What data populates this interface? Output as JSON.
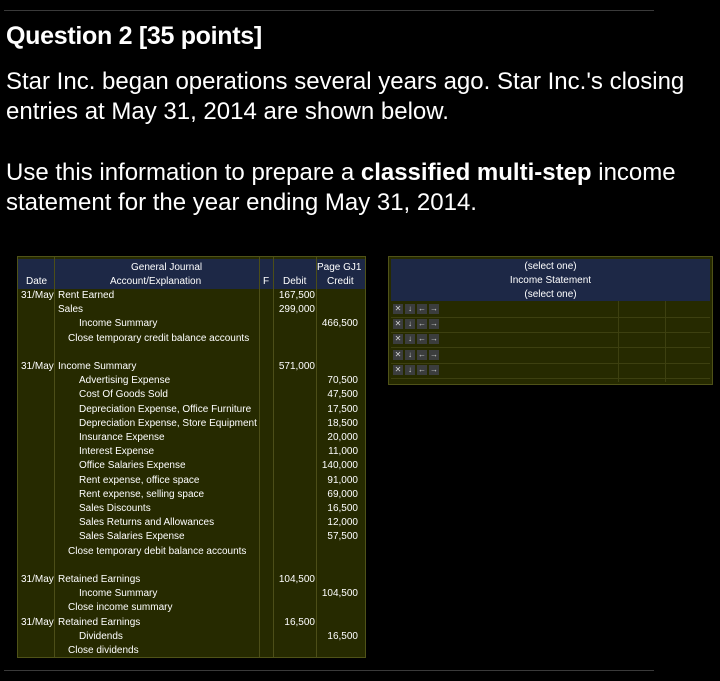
{
  "question": {
    "title": "Question 2 [35 points]",
    "intro": "Star Inc. began operations several years ago. Star Inc.'s closing entries at May 31, 2014 are shown below.",
    "instruction_pre": "Use this information to prepare a ",
    "instruction_bold": "classified multi-step",
    "instruction_post": " income statement for the year ending May 31, 2014."
  },
  "journal": {
    "title": "General Journal",
    "page": "Page GJ1",
    "headers": {
      "date": "Date",
      "account": "Account/Explanation",
      "f": "F",
      "debit": "Debit",
      "credit": "Credit"
    },
    "rows": [
      {
        "date": "31/May",
        "account": "Rent Earned",
        "indent": 0,
        "debit": "167,500",
        "credit": ""
      },
      {
        "date": "",
        "account": "Sales",
        "indent": 0,
        "debit": "299,000",
        "credit": ""
      },
      {
        "date": "",
        "account": "Income Summary",
        "indent": 2,
        "debit": "",
        "credit": "466,500"
      },
      {
        "date": "",
        "account": "Close temporary credit balance accounts",
        "indent": 1,
        "debit": "",
        "credit": ""
      },
      {
        "date": "",
        "account": "",
        "indent": 0,
        "debit": "",
        "credit": ""
      },
      {
        "date": "31/May",
        "account": "Income Summary",
        "indent": 0,
        "debit": "571,000",
        "credit": ""
      },
      {
        "date": "",
        "account": "Advertising Expense",
        "indent": 2,
        "debit": "",
        "credit": "70,500"
      },
      {
        "date": "",
        "account": "Cost Of Goods Sold",
        "indent": 2,
        "debit": "",
        "credit": "47,500"
      },
      {
        "date": "",
        "account": "Depreciation Expense, Office Furniture",
        "indent": 2,
        "debit": "",
        "credit": "17,500"
      },
      {
        "date": "",
        "account": "Depreciation Expense, Store Equipment",
        "indent": 2,
        "debit": "",
        "credit": "18,500"
      },
      {
        "date": "",
        "account": "Insurance Expense",
        "indent": 2,
        "debit": "",
        "credit": "20,000"
      },
      {
        "date": "",
        "account": "Interest Expense",
        "indent": 2,
        "debit": "",
        "credit": "11,000"
      },
      {
        "date": "",
        "account": "Office Salaries Expense",
        "indent": 2,
        "debit": "",
        "credit": "140,000"
      },
      {
        "date": "",
        "account": "Rent expense, office space",
        "indent": 2,
        "debit": "",
        "credit": "91,000"
      },
      {
        "date": "",
        "account": "Rent expense, selling space",
        "indent": 2,
        "debit": "",
        "credit": "69,000"
      },
      {
        "date": "",
        "account": "Sales Discounts",
        "indent": 2,
        "debit": "",
        "credit": "16,500"
      },
      {
        "date": "",
        "account": "Sales Returns and Allowances",
        "indent": 2,
        "debit": "",
        "credit": "12,000"
      },
      {
        "date": "",
        "account": "Sales Salaries Expense",
        "indent": 2,
        "debit": "",
        "credit": "57,500"
      },
      {
        "date": "",
        "account": "Close temporary debit balance accounts",
        "indent": 1,
        "debit": "",
        "credit": ""
      },
      {
        "date": "",
        "account": "",
        "indent": 0,
        "debit": "",
        "credit": ""
      },
      {
        "date": "31/May",
        "account": "Retained Earnings",
        "indent": 0,
        "debit": "104,500",
        "credit": ""
      },
      {
        "date": "",
        "account": "Income Summary",
        "indent": 2,
        "debit": "",
        "credit": "104,500"
      },
      {
        "date": "",
        "account": "Close income summary",
        "indent": 1,
        "debit": "",
        "credit": ""
      },
      {
        "date": "31/May",
        "account": "Retained Earnings",
        "indent": 0,
        "debit": "16,500",
        "credit": ""
      },
      {
        "date": "",
        "account": "Dividends",
        "indent": 2,
        "debit": "",
        "credit": "16,500"
      },
      {
        "date": "",
        "account": "Close dividends",
        "indent": 1,
        "debit": "",
        "credit": ""
      }
    ]
  },
  "income_statement": {
    "header_select_1": "(select one)",
    "header_title": "Income Statement",
    "header_select_2": "(select one)",
    "row_controls": [
      "delete-icon",
      "insert-below-icon",
      "outdent-icon",
      "indent-icon"
    ],
    "row_control_glyphs": [
      "✕",
      "↓",
      "←",
      "→"
    ],
    "row_count": 5
  }
}
